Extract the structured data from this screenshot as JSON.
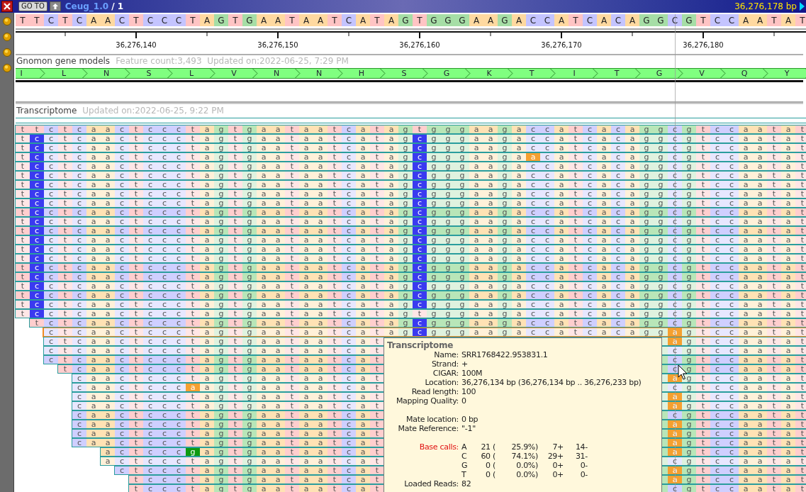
{
  "title_bar": {
    "goto": "GO TO",
    "title": "Ceug_1.0",
    "title_suffix": "/ 1",
    "position": "36,276,178 bp"
  },
  "reference": "T T C T C A A C T C C C T A G T G A A T A A T C A T A G T G G G A A G A C C A T C A C A G G C G T C C A A T A T",
  "ruler_labels": [
    "36,276,140",
    "36,276,150",
    "36,276,160",
    "36,276,170",
    "36,276,180"
  ],
  "gene_track": {
    "name": "Gnomon gene models",
    "info": "Feature count:3,493  Updated on:2022-06-25, 7:29 PM",
    "amino_acids": [
      "I",
      "L",
      "N",
      "S",
      "L",
      "V",
      "N",
      "N",
      "H",
      "S",
      "G",
      "K",
      "T",
      "I",
      "T",
      "G",
      "V",
      "Q",
      "Y"
    ]
  },
  "read_track": {
    "name": "Transcriptome",
    "info": "Updated on:2022-06-25, 9:22 PM"
  },
  "reads": [
    {
      "dimmed": false,
      "selected": false,
      "segments": [
        {
          "bases": "t t c t c a a c t c c c t a g t g a a t a a t c a t a g t g g g a a g a c c a t c a c a g g c g t c c a a t a t",
          "mismatch": false
        }
      ]
    },
    {
      "dimmed": true,
      "selected": false,
      "segments": [
        {
          "bases": "t",
          "mismatch": false
        },
        {
          "bases": "c",
          "mismatch": true
        },
        {
          "bases": "c t c a a c t c c c t a g t g a a t a a t c a t a g",
          "mismatch": false
        },
        {
          "bases": "c",
          "mismatch": true
        },
        {
          "bases": "g g g a a g a c c a t c a c a g g c g t c c a a t a t",
          "mismatch": false
        }
      ]
    },
    {
      "dimmed": true,
      "selected": false,
      "segments": [
        {
          "bases": "t",
          "mismatch": false
        },
        {
          "bases": "c",
          "mismatch": true
        },
        {
          "bases": "c t c a a c t c c c t a g t g a a t a a t c a t a g",
          "mismatch": false
        },
        {
          "bases": "c",
          "mismatch": true
        },
        {
          "bases": "g g g a a g a c c a t c a c a g g c g t c c a a t a t",
          "mismatch": false
        }
      ]
    },
    {
      "dimmed": true,
      "selected": false,
      "segments": [
        {
          "bases": "t",
          "mismatch": false
        },
        {
          "bases": "c",
          "mismatch": true
        },
        {
          "bases": "c t c a a c t c c c t a g t g a a t a a t c a t a g",
          "mismatch": false
        },
        {
          "bases": "c",
          "mismatch": true
        },
        {
          "bases": "g g g a a g a",
          "mismatch": false
        },
        {
          "bases": "a",
          "mismatch": true
        },
        {
          "bases": "c a t c a c a g g c g t c c a a t a t",
          "mismatch": false
        }
      ]
    },
    {
      "dimmed": true,
      "selected": false,
      "segments": [
        {
          "bases": "t",
          "mismatch": false
        },
        {
          "bases": "c",
          "mismatch": true
        },
        {
          "bases": "c t c a a c t c c c t a g t g a a t a a t c a t a g",
          "mismatch": false
        },
        {
          "bases": "c",
          "mismatch": true
        },
        {
          "bases": "g g g a a g a c c a t c a c a g g c g t c c a a t a t",
          "mismatch": false
        }
      ]
    },
    {
      "dimmed": true,
      "selected": false,
      "segments": [
        {
          "bases": "t",
          "mismatch": false
        },
        {
          "bases": "c",
          "mismatch": true
        },
        {
          "bases": "c t c a a c t c c c t a g t g a a t a a t c a t a g",
          "mismatch": false
        },
        {
          "bases": "c",
          "mismatch": true
        },
        {
          "bases": "g g g a a g a c c a t c a c a g g c g t c c a a t a t",
          "mismatch": false
        }
      ]
    },
    {
      "dimmed": true,
      "selected": false,
      "segments": [
        {
          "bases": "t",
          "mismatch": false
        },
        {
          "bases": "c",
          "mismatch": true
        },
        {
          "bases": "c t c a a c t c c c t a g t g a a t a a t c a t a g",
          "mismatch": false
        },
        {
          "bases": "c",
          "mismatch": true
        },
        {
          "bases": "g g g a a g a c c a t c a c a g g c g t c c a a t a t",
          "mismatch": false
        }
      ]
    },
    {
      "dimmed": true,
      "selected": false,
      "segments": [
        {
          "bases": "t",
          "mismatch": false
        },
        {
          "bases": "c",
          "mismatch": true
        },
        {
          "bases": "c t c a a c t c c c t a g t g a a t a a t c a t a g",
          "mismatch": false
        },
        {
          "bases": "c",
          "mismatch": true
        },
        {
          "bases": "g g g a a g a c c a t c a c a g g c g t c c a a t a t",
          "mismatch": false
        }
      ]
    },
    {
      "dimmed": true,
      "selected": false,
      "segments": [
        {
          "bases": "t",
          "mismatch": false
        },
        {
          "bases": "c",
          "mismatch": true
        },
        {
          "bases": "c t c a a c t c c c t a g t g a a t a a t c a t a g",
          "mismatch": false
        },
        {
          "bases": "c",
          "mismatch": true
        },
        {
          "bases": "g g g a a g a c c a t c a c a g g c g t c c a a t a t",
          "mismatch": false
        }
      ]
    },
    {
      "dimmed": false,
      "selected": false,
      "segments": [
        {
          "bases": "t",
          "mismatch": false
        },
        {
          "bases": "c",
          "mismatch": true
        },
        {
          "bases": "c t c a a c t c c c t a g t g a a t a a t c a t a g",
          "mismatch": false
        },
        {
          "bases": "c",
          "mismatch": true
        },
        {
          "bases": "g g g a a g a c c a t c a c a g g c g t c c a a t a t",
          "mismatch": false
        }
      ]
    },
    {
      "dimmed": true,
      "selected": false,
      "segments": [
        {
          "bases": "t",
          "mismatch": false
        },
        {
          "bases": "c",
          "mismatch": true
        },
        {
          "bases": "c t c a a c t c c c t a g t g a a t a a t c a t a g",
          "mismatch": false
        },
        {
          "bases": "c",
          "mismatch": true
        },
        {
          "bases": "g g g a a g a c c a t c a c a g g c g t c c a a t a t",
          "mismatch": false
        }
      ]
    },
    {
      "dimmed": false,
      "selected": false,
      "segments": [
        {
          "bases": "t",
          "mismatch": false
        },
        {
          "bases": "c",
          "mismatch": true
        },
        {
          "bases": "c t c a a c t c c c t a g t g a a t a a t c a t a g",
          "mismatch": false
        },
        {
          "bases": "c",
          "mismatch": true
        },
        {
          "bases": "g g g a a g a c c a t c a c a g g c g t c c a a t a t",
          "mismatch": false
        }
      ]
    },
    {
      "dimmed": true,
      "selected": false,
      "segments": [
        {
          "bases": "t",
          "mismatch": false
        },
        {
          "bases": "c",
          "mismatch": true
        },
        {
          "bases": "c t c a a c t c c c t a g t g a a t a a t c a t a g",
          "mismatch": false
        },
        {
          "bases": "c",
          "mismatch": true
        },
        {
          "bases": "g g g a a g a c c a t c a c a g g c g t c c a a t a t",
          "mismatch": false
        }
      ]
    },
    {
      "dimmed": true,
      "selected": false,
      "segments": [
        {
          "bases": "t",
          "mismatch": false
        },
        {
          "bases": "c",
          "mismatch": true
        },
        {
          "bases": "c t c a a c t c c c t a g t g a a t a a t c a t a g",
          "mismatch": false
        },
        {
          "bases": "c",
          "mismatch": true
        },
        {
          "bases": "g g g a a g a c c a t c a c a g g c g t c c a a t a t",
          "mismatch": false
        }
      ]
    },
    {
      "dimmed": true,
      "selected": false,
      "segments": [
        {
          "bases": "t",
          "mismatch": false
        },
        {
          "bases": "c",
          "mismatch": true
        },
        {
          "bases": "c t c a a c t c c c t a g t g a a t a a t c a t a g",
          "mismatch": false
        },
        {
          "bases": "c",
          "mismatch": true
        },
        {
          "bases": "g g g a a g a c c a t c a c a g g c g t c c a a t a t",
          "mismatch": false
        }
      ]
    },
    {
      "dimmed": false,
      "selected": false,
      "segments": [
        {
          "bases": "t",
          "mismatch": false
        },
        {
          "bases": "c",
          "mismatch": true
        },
        {
          "bases": "c t c a a c t c c c t a g t g a a t a a t c a t a g",
          "mismatch": false
        },
        {
          "bases": "c",
          "mismatch": true
        },
        {
          "bases": "g g g a a g a c c a t c a c a g g c g t c c a a t a t",
          "mismatch": false
        }
      ]
    },
    {
      "dimmed": false,
      "selected": false,
      "segments": [
        {
          "bases": "t",
          "mismatch": false
        },
        {
          "bases": "c",
          "mismatch": true
        },
        {
          "bases": "c t c a a c t c c c t a g t g a a t a a t c a t a g",
          "mismatch": false
        },
        {
          "bases": "c",
          "mismatch": true
        },
        {
          "bases": "g g g a a g a c c a t c a c a g g c g t c c a a t a t",
          "mismatch": false
        }
      ]
    },
    {
      "dimmed": true,
      "selected": false,
      "segments": [
        {
          "bases": "t",
          "mismatch": false
        },
        {
          "bases": "c",
          "mismatch": true
        },
        {
          "bases": "c t c a a c t c c c t a g t g a a t a a t c a t a g",
          "mismatch": false
        },
        {
          "bases": "c",
          "mismatch": true
        },
        {
          "bases": "g g g a a g a c c a t c a c a g g c g t c c a a t a t",
          "mismatch": false
        }
      ]
    },
    {
      "dimmed": false,
      "selected": false,
      "segments": [
        {
          "bases": "t",
          "mismatch": false
        },
        {
          "bases": "c",
          "mismatch": true
        },
        {
          "bases": "c t c a a c t c c c t a g t g a a t a a t c a t a g",
          "mismatch": false
        },
        {
          "bases": "c",
          "mismatch": true
        },
        {
          "bases": "g g g a a g a c c a t c a c a g g c g t c c a a t a t",
          "mismatch": false
        }
      ]
    },
    {
      "dimmed": true,
      "selected": false,
      "segments": [
        {
          "bases": "t",
          "mismatch": false
        },
        {
          "bases": "c",
          "mismatch": true
        },
        {
          "bases": "c t c a a c t c c c t a g t g a a t a a t c a t a g",
          "mismatch": false
        },
        {
          "bases": "c",
          "mismatch": true
        },
        {
          "bases": "g g g a a g a c c a t c a c a g g c g t c c a a t a t",
          "mismatch": false
        }
      ]
    },
    {
      "dimmed": true,
      "selected": false,
      "segments": [
        {
          "bases": "t",
          "mismatch": false
        },
        {
          "bases": "c",
          "mismatch": true
        },
        {
          "bases": "c t c a a c t c c c t a g t g a a t a a t c a t a g t g g g a a g a c c a t c a c a g g c g t c c a a t a t",
          "mismatch": false
        }
      ]
    },
    {
      "dimmed": false,
      "selected": false,
      "segments": [
        {
          "bases": "t c t c a a c t c c c t a g t g a a t a a t c a t a g",
          "mismatch": false
        },
        {
          "bases": "c",
          "mismatch": true
        },
        {
          "bases": "g g g a a g a c c a t c a c a g g c g t c c a a t a t",
          "mismatch": false
        }
      ]
    },
    {
      "dimmed": true,
      "selected": true,
      "segments": [
        {
          "bases": "c t c a a c t c c c t a g t g a a t a a t c a t a g",
          "mismatch": false
        },
        {
          "bases": "c",
          "mismatch": true
        },
        {
          "bases": "g g g a a g a c c a t c a c a g g",
          "mismatch": false
        },
        {
          "bases": "a",
          "mismatch": true
        },
        {
          "bases": "g t c c a a t a t",
          "mismatch": false
        }
      ]
    },
    {
      "dimmed": true,
      "selected": false,
      "segments": [
        {
          "bases": "c t c a a c t c c c t a g t g a a t a a t c a t",
          "mismatch": false
        }
      ],
      "segments_after": [
        {
          "bases": "a",
          "mismatch": true
        },
        {
          "bases": "g t c c a a t a t",
          "mismatch": false
        }
      ]
    },
    {
      "dimmed": true,
      "selected": false,
      "segments": [
        {
          "bases": "c t c a a c t c c c t a g t g a a t a a t c a t",
          "mismatch": false
        }
      ],
      "segments_after": [
        {
          "bases": "c g t c c a a t a t",
          "mismatch": false
        }
      ]
    },
    {
      "dimmed": false,
      "selected": false,
      "segments": [
        {
          "bases": "c t c a a c t c c c t a g t g a a t a a t c a t",
          "mismatch": false
        }
      ],
      "segments_after": [
        {
          "bases": "c g t c c a a t a t",
          "mismatch": false
        }
      ]
    },
    {
      "dimmed": false,
      "selected": false,
      "segments": [
        {
          "bases": "t c a a c t c c c t a g t g a a t a a t c a t",
          "mismatch": false
        }
      ],
      "segments_after": [
        {
          "bases": "c g t c c a a t a t",
          "mismatch": false
        }
      ]
    },
    {
      "dimmed": true,
      "selected": false,
      "segments": [
        {
          "bases": "c a a c t c c c t a g t g a a t a a t c a t",
          "mismatch": false
        }
      ],
      "segments_after": [
        {
          "bases": "a",
          "mismatch": true
        },
        {
          "bases": "g t c c a a t a t",
          "mismatch": false
        }
      ]
    },
    {
      "dimmed": true,
      "selected": false,
      "segments": [
        {
          "bases": "c a a c t c c c",
          "mismatch": false
        },
        {
          "bases": "a",
          "mismatch": true
        },
        {
          "bases": "a g t g a a t a a t c a t",
          "mismatch": false
        }
      ],
      "segments_after": [
        {
          "bases": "c g t c c a a t a t",
          "mismatch": false
        }
      ]
    },
    {
      "dimmed": true,
      "selected": false,
      "segments": [
        {
          "bases": "c a a c t c c c t a g t g a a t a a t c a t",
          "mismatch": false
        }
      ],
      "segments_after": [
        {
          "bases": "a",
          "mismatch": true
        },
        {
          "bases": "g t c c a a t a t",
          "mismatch": false
        }
      ]
    },
    {
      "dimmed": true,
      "selected": false,
      "segments": [
        {
          "bases": "c a a c t c c c t a g t g a a t a a t c a t",
          "mismatch": false
        }
      ],
      "segments_after": [
        {
          "bases": "a",
          "mismatch": true
        },
        {
          "bases": "g t c c a a t a t",
          "mismatch": false
        }
      ]
    },
    {
      "dimmed": false,
      "selected": false,
      "segments": [
        {
          "bases": "c a a c t c c c t a g t g a a t a a t c a t",
          "mismatch": false
        }
      ],
      "segments_after": [
        {
          "bases": "c g t c c a a t a t",
          "mismatch": false
        }
      ]
    },
    {
      "dimmed": false,
      "selected": false,
      "segments": [
        {
          "bases": "c a a c t c c c t a g t g a a t a a t c a t",
          "mismatch": false
        }
      ],
      "segments_after": [
        {
          "bases": "a",
          "mismatch": true
        },
        {
          "bases": "g t c c a a t a t",
          "mismatch": false
        }
      ]
    },
    {
      "dimmed": false,
      "selected": false,
      "segments": [
        {
          "bases": "c a a c t c c c t a g t g a a t a a t c a t",
          "mismatch": false
        }
      ],
      "segments_after": [
        {
          "bases": "a",
          "mismatch": true
        },
        {
          "bases": "g t c c a a t a t",
          "mismatch": false
        }
      ]
    },
    {
      "dimmed": false,
      "selected": false,
      "segments": [
        {
          "bases": "c a a c t c c c t a g t g a a t a a t c a t",
          "mismatch": false
        }
      ],
      "segments_after": [
        {
          "bases": "a",
          "mismatch": true
        },
        {
          "bases": "g t c c a a t a t",
          "mismatch": false
        }
      ]
    },
    {
      "dimmed": false,
      "selected": false,
      "segments": [
        {
          "bases": "a c t c c c",
          "mismatch": false
        },
        {
          "bases": "g",
          "mismatch": true
        },
        {
          "bases": "a g t g a a t a a t c a t",
          "mismatch": false
        }
      ],
      "segments_after": [
        {
          "bases": "a",
          "mismatch": true
        },
        {
          "bases": "g t c c a a t a t",
          "mismatch": false
        }
      ]
    },
    {
      "dimmed": true,
      "selected": false,
      "segments": [
        {
          "bases": "a c t c c c t a g t g a a t a a t c a t",
          "mismatch": false
        }
      ],
      "segments_after": [
        {
          "bases": "c g t c c a a t a t",
          "mismatch": false
        }
      ]
    },
    {
      "dimmed": false,
      "selected": false,
      "segments": [
        {
          "bases": "c t c c c t a g t g a a t a a t c a t",
          "mismatch": false
        }
      ],
      "segments_after": [
        {
          "bases": "a",
          "mismatch": true
        },
        {
          "bases": "g t c c a a t a t",
          "mismatch": false
        }
      ]
    },
    {
      "dimmed": false,
      "selected": false,
      "segments": [
        {
          "bases": "t c c c t a g t g a a t a a t c a t",
          "mismatch": false
        }
      ],
      "segments_after": [
        {
          "bases": "a",
          "mismatch": true
        },
        {
          "bases": "g t c c a a t a t",
          "mismatch": false
        }
      ]
    },
    {
      "dimmed": false,
      "selected": false,
      "segments": [
        {
          "bases": "t c c c t a g t g a a t a a t c a t",
          "mismatch": false
        }
      ],
      "segments_after": [
        {
          "bases": "c g t c c a a t a t",
          "mismatch": false
        }
      ]
    }
  ],
  "popup": {
    "title": "Transcriptome",
    "sections": [
      [
        {
          "label": "Name:",
          "value": "SRR1768422.953831.1"
        },
        {
          "label": "Strand:",
          "value": "+"
        },
        {
          "label": "CIGAR:",
          "value": "100M"
        },
        {
          "label": "Location:",
          "value": "36,276,134 bp (36,276,134 bp .. 36,276,233 bp)"
        },
        {
          "label": "Read length:",
          "value": "100"
        },
        {
          "label": "Mapping Quality:",
          "value": "0"
        }
      ],
      [
        {
          "label": "Mate location:",
          "value": "0 bp"
        },
        {
          "label": "Mate Reference:",
          "value": "\"-1\""
        }
      ]
    ],
    "base_calls": {
      "label": "Base calls:",
      "lines": [
        [
          "A",
          "21 (",
          "25.9%)",
          "7+",
          "14-"
        ],
        [
          "C",
          "60 (",
          "74.1%)",
          "29+",
          "31-"
        ],
        [
          "G",
          "0 (",
          "0.0%)",
          "0+",
          "0-"
        ],
        [
          "T",
          "0 (",
          "0.0%)",
          "0+",
          "0-"
        ]
      ]
    },
    "footer": {
      "label": "Loaded Reads:",
      "value": "82"
    }
  }
}
